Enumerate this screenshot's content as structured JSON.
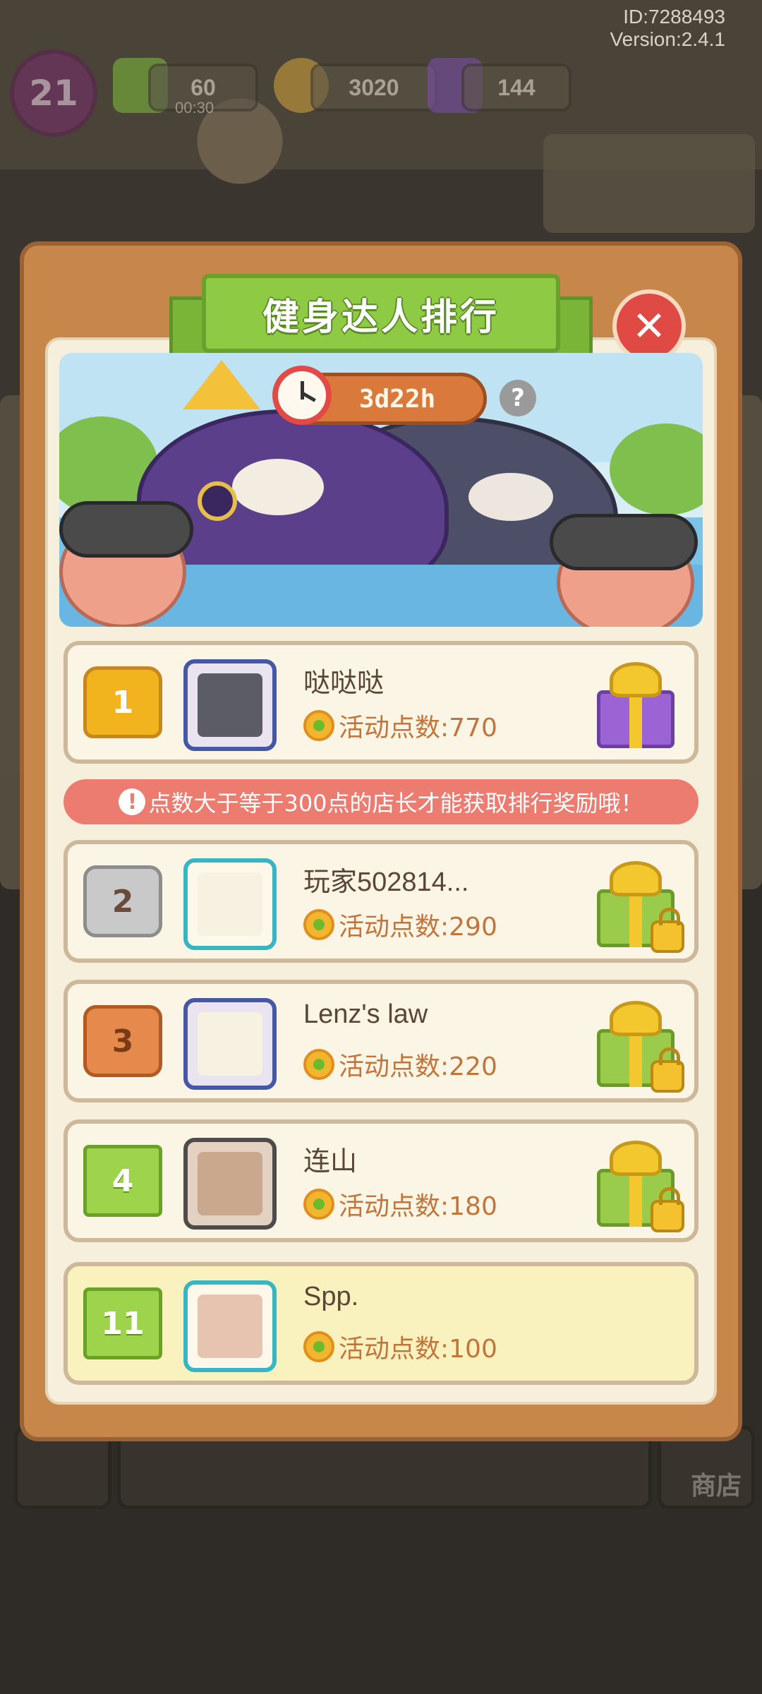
{
  "header": {
    "id_label": "ID:7288493",
    "version_label": "Version:2.4.1"
  },
  "hud": {
    "level": "21",
    "energy": "60",
    "energy_timer": "00:30",
    "coins": "3020",
    "gems": "144"
  },
  "modal": {
    "title": "健身达人排行",
    "timer": "3d22h",
    "help_label": "?",
    "close_label": "✕",
    "notice": "点数大于等于300点的店长才能获取排行奖励哦！",
    "notice_icon": "!"
  },
  "leaderboard": [
    {
      "rank": "1",
      "name": "哒哒哒",
      "points": "活动点数:770",
      "badge": "gold-crown",
      "reward": "purple-gift"
    },
    {
      "rank": "2",
      "name": "玩家502814...",
      "points": "活动点数:290",
      "badge": "silver-crown",
      "reward": "locked-green-gift"
    },
    {
      "rank": "3",
      "name": "Lenz's law",
      "points": "活动点数:220",
      "badge": "bronze-crown",
      "reward": "locked-green-gift"
    },
    {
      "rank": "4",
      "name": "连山",
      "points": "活动点数:180",
      "badge": "green-ribbon",
      "reward": "locked-green-gift"
    },
    {
      "rank": "11",
      "name": "Spp.",
      "points": "活动点数:100",
      "badge": "green-ribbon",
      "reward": ""
    }
  ],
  "bottom": {
    "shop_label": "商店"
  },
  "colors": {
    "accent_green": "#8fca45",
    "modal_brown": "#c7874a",
    "points_orange": "#c2753b",
    "notice_red": "#ec7b70",
    "close_red": "#e04a45"
  }
}
